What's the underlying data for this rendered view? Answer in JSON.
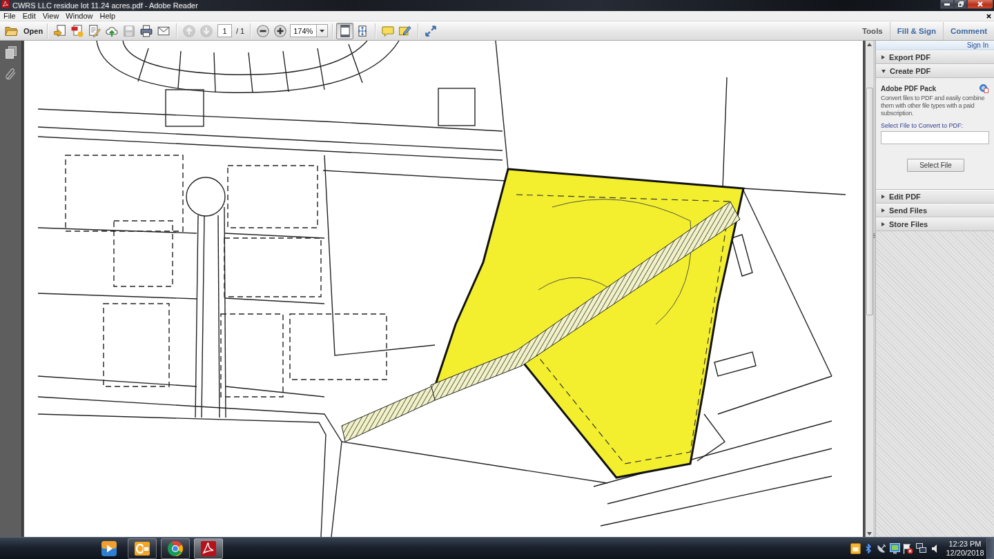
{
  "window": {
    "title": "CWRS LLC residue lot 11.24 acres.pdf - Adobe Reader"
  },
  "menu_bar": {
    "items": [
      "File",
      "Edit",
      "View",
      "Window",
      "Help"
    ]
  },
  "toolbar": {
    "open_label": "Open",
    "groups": [
      {
        "items": [
          {
            "kind": "convert",
            "disabled": false
          },
          {
            "kind": "pdf",
            "disabled": false
          },
          {
            "kind": "edit",
            "disabled": false
          },
          {
            "kind": "cloud",
            "disabled": false
          },
          {
            "kind": "save",
            "disabled": true
          },
          {
            "kind": "print",
            "disabled": false
          },
          {
            "kind": "email",
            "disabled": false
          }
        ]
      },
      {
        "items": [
          {
            "kind": "prev",
            "disabled": true
          },
          {
            "kind": "next",
            "disabled": true
          },
          {
            "kind": "page-field",
            "value": "1"
          },
          {
            "kind": "page-total",
            "text": "/ 1"
          }
        ]
      },
      {
        "items": [
          {
            "kind": "zoom-out",
            "disabled": false
          },
          {
            "kind": "zoom-in",
            "disabled": false
          },
          {
            "kind": "zoom-field",
            "value": "174%"
          }
        ]
      },
      {
        "items": [
          {
            "kind": "fit-page",
            "disabled": false,
            "selected": true
          },
          {
            "kind": "fit-width",
            "disabled": false,
            "selected": false
          }
        ]
      },
      {
        "items": [
          {
            "kind": "comment",
            "disabled": false
          },
          {
            "kind": "highlight",
            "disabled": false
          }
        ]
      },
      {
        "items": [
          {
            "kind": "full-screen",
            "disabled": false
          }
        ]
      }
    ],
    "panel_tabs": [
      {
        "label": "Tools",
        "selected": true
      },
      {
        "label": "Fill & Sign",
        "selected": false
      },
      {
        "label": "Comment",
        "selected": false
      }
    ]
  },
  "side_panel": {
    "sign_in": "Sign In",
    "sections": [
      {
        "label": "Export PDF",
        "expanded": false
      },
      {
        "label": "Create PDF",
        "expanded": true,
        "content": {
          "title": "Adobe PDF Pack",
          "description": "Convert files to PDF and easily combine them with other file types with a paid subscription.",
          "field_label": "Select File to Convert to PDF:",
          "button": "Select File"
        }
      },
      {
        "label": "Edit PDF",
        "expanded": false
      },
      {
        "label": "Send Files",
        "expanded": false
      },
      {
        "label": "Store Files",
        "expanded": false
      }
    ]
  },
  "taskbar": {
    "apps": [
      {
        "kind": "media-player",
        "running": false,
        "selected": false
      },
      {
        "kind": "outlook",
        "running": true,
        "selected": false
      },
      {
        "kind": "chrome",
        "running": true,
        "selected": false
      },
      {
        "kind": "acrobat",
        "running": true,
        "selected": true
      }
    ],
    "clock": {
      "time": "12:23 PM",
      "date": "12/20/2018"
    }
  }
}
